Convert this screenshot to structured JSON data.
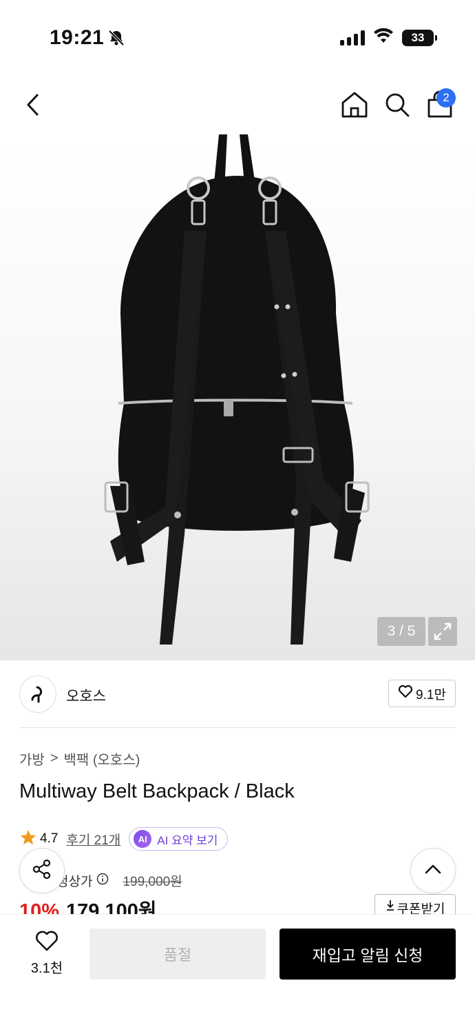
{
  "status_bar": {
    "time": "19:21",
    "battery": "33",
    "icons": [
      "bell-slash-icon",
      "signal-icon",
      "wifi-icon",
      "battery-icon"
    ]
  },
  "nav": {
    "icons": [
      "back-arrow-icon",
      "home-icon",
      "search-icon",
      "cart-icon"
    ],
    "cart_badge": "2"
  },
  "gallery": {
    "counter": "3 / 5",
    "icons": [
      "expand-icon"
    ]
  },
  "brand": {
    "name": "오호스",
    "like_count": "9.1만",
    "icons": [
      "brand-logo-icon",
      "heart-outline-icon"
    ]
  },
  "breadcrumb": {
    "category": "가방",
    "separator": ">",
    "subcategory": "백팩 (오호스)"
  },
  "product": {
    "title": "Multiway Belt Backpack / Black",
    "rating": "4.7",
    "reviews": "후기 21개",
    "ai_badge": "AI",
    "ai_summary": "AI 요약 보기",
    "price_label": "정상가",
    "original_price": "199,000원",
    "discount": "10%",
    "sale_price": "179,100원",
    "coupon": "쿠폰받기"
  },
  "bottom_bar": {
    "wish_count": "3.1천",
    "soldout_label": "품절",
    "restock_label": "재입고 알림 신청"
  },
  "colors": {
    "accent_blue": "#2b6ff2",
    "discount_red": "#e0201e",
    "ai_purple": "#6a3fd6",
    "star_orange": "#f29a1f"
  }
}
